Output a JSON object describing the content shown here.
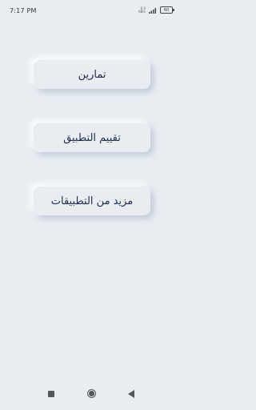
{
  "status_bar": {
    "time": "7:17 PM",
    "net_speed_value": "0.0",
    "net_speed_unit": "KB/s",
    "battery_level": "60"
  },
  "menu": {
    "exercises": "تمارين",
    "rate_app": "تقييم التطبيق",
    "more_apps": "مزيد من التطبيقات"
  },
  "nav_bar": {
    "recent_icon": "square-icon",
    "home_icon": "circle-icon",
    "back_icon": "triangle-back-icon"
  }
}
